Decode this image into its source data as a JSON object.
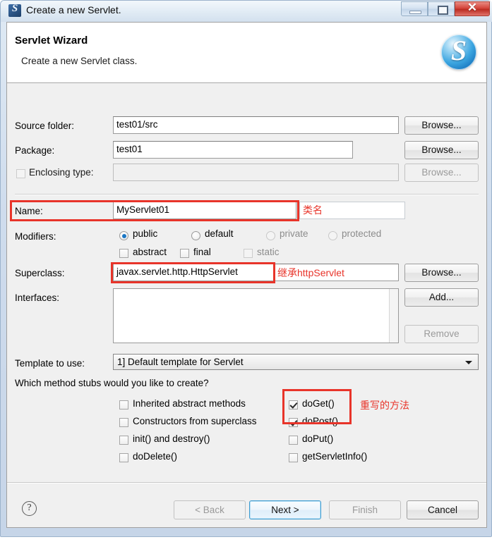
{
  "window": {
    "title": "Create a new Servlet.",
    "icon": "servlet-app-icon",
    "icon_glyph": "S",
    "minimize_label": "",
    "maximize_label": "",
    "close_label": "✕"
  },
  "banner": {
    "title": "Servlet Wizard",
    "description": "Create a new Servlet class.",
    "logo_glyph": "S",
    "logo_color": "#2e9ade"
  },
  "form": {
    "source_folder": {
      "label": "Source folder:",
      "value": "test01/src",
      "browse": "Browse..."
    },
    "package": {
      "label": "Package:",
      "value": "test01",
      "browse": "Browse..."
    },
    "enclosing_type": {
      "label": "Enclosing type:",
      "value": "",
      "browse": "Browse...",
      "checked": false,
      "enabled": false
    },
    "name": {
      "label": "Name:",
      "value": "MyServlet01"
    },
    "modifiers": {
      "label": "Modifiers:",
      "radios": [
        {
          "label": "public",
          "checked": true,
          "enabled": true
        },
        {
          "label": "default",
          "checked": false,
          "enabled": true
        },
        {
          "label": "private",
          "checked": false,
          "enabled": false
        },
        {
          "label": "protected",
          "checked": false,
          "enabled": false
        }
      ],
      "checkboxes": [
        {
          "label": "abstract",
          "checked": false,
          "enabled": true
        },
        {
          "label": "final",
          "checked": false,
          "enabled": true
        },
        {
          "label": "static",
          "checked": false,
          "enabled": false
        }
      ]
    },
    "superclass": {
      "label": "Superclass:",
      "value": "javax.servlet.http.HttpServlet",
      "browse": "Browse..."
    },
    "interfaces": {
      "label": "Interfaces:",
      "items": [],
      "add": "Add...",
      "remove": "Remove"
    },
    "template": {
      "label": "Template to use:",
      "selected": "1] Default template for Servlet"
    },
    "stubs": {
      "question": "Which method stubs would you like to create?",
      "left": [
        {
          "label": "Inherited abstract methods",
          "checked": false
        },
        {
          "label": "Constructors from superclass",
          "checked": false
        },
        {
          "label": "init() and destroy()",
          "checked": false
        },
        {
          "label": "doDelete()",
          "checked": false
        }
      ],
      "right": [
        {
          "label": "doGet()",
          "checked": true
        },
        {
          "label": "doPost()",
          "checked": true
        },
        {
          "label": "doPut()",
          "checked": false
        },
        {
          "label": "getServletInfo()",
          "checked": false
        }
      ]
    }
  },
  "annotations": {
    "color": "#e8342a",
    "name_note": "类名",
    "superclass_note": "继承httpServlet",
    "stubs_note": "重写的方法"
  },
  "footer": {
    "help": "?",
    "back": "< Back",
    "next": "Next >",
    "finish": "Finish",
    "cancel": "Cancel"
  }
}
